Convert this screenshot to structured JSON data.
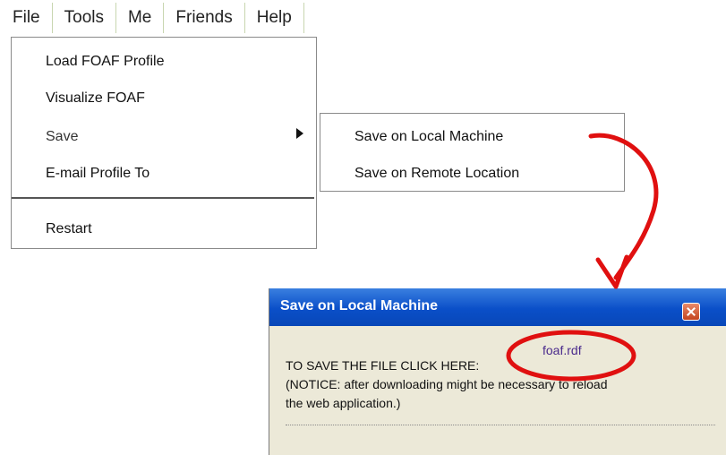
{
  "menubar": {
    "items": [
      "File",
      "Tools",
      "Me",
      "Friends",
      "Help"
    ]
  },
  "file_menu": {
    "items": [
      "Load FOAF Profile",
      "Visualize FOAF",
      "Save",
      "E-mail Profile To",
      "Restart"
    ]
  },
  "save_submenu": {
    "items": [
      "Save on Local Machine",
      "Save on Remote Location"
    ]
  },
  "dialog": {
    "title": "Save on Local Machine",
    "instruction": "TO SAVE THE FILE CLICK HERE:",
    "link": "foaf.rdf",
    "notice_line1": "(NOTICE: after downloading might be necessary to reload",
    "notice_line2": "the web application.)"
  },
  "annotation_color": "#e01010"
}
